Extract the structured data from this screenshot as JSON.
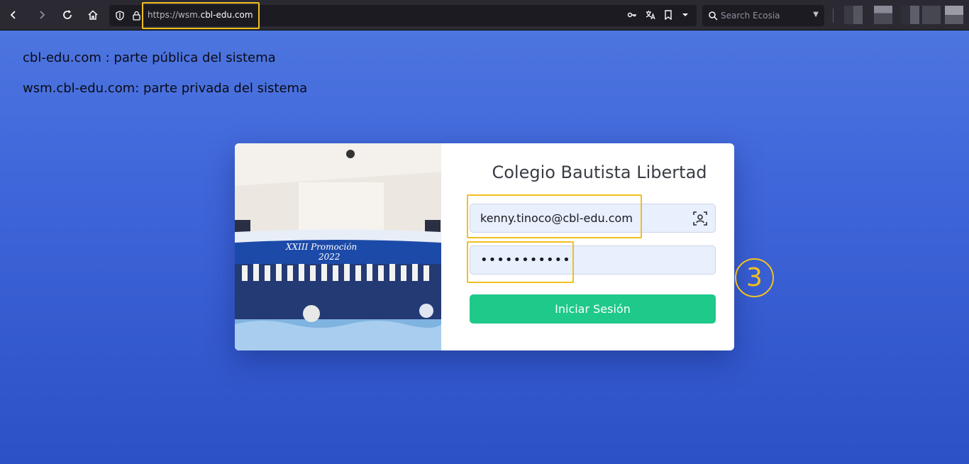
{
  "browser": {
    "url_prefix": "https://wsm.",
    "url_domain": "cbl-edu.com",
    "search_placeholder": "Search Ecosia"
  },
  "page": {
    "line1": "cbl-edu.com : parte pública del sistema",
    "line2": "wsm.cbl-edu.com: parte privada del sistema"
  },
  "login": {
    "title": "Colegio Bautista Libertad",
    "email_value": "kenny.tinoco@cbl-edu.com",
    "password_value": "•••••••••••",
    "submit_label": "Iniciar Sesión",
    "photo_banner_line1": "XXIII  Promoción",
    "photo_banner_line2": "2022"
  },
  "annotation": {
    "step_number": "3",
    "highlight_color": "#f0c020"
  },
  "colors": {
    "accent_button": "#1ec98a",
    "background_top": "#5078e0",
    "background_bottom": "#2c50c6"
  },
  "icons": [
    "back-icon",
    "forward-icon",
    "reload-icon",
    "home-icon",
    "shield-icon",
    "lock-icon",
    "key-icon",
    "translate-icon",
    "bookmark-icon",
    "chevron-down-icon",
    "search-icon",
    "contact-card-icon"
  ]
}
